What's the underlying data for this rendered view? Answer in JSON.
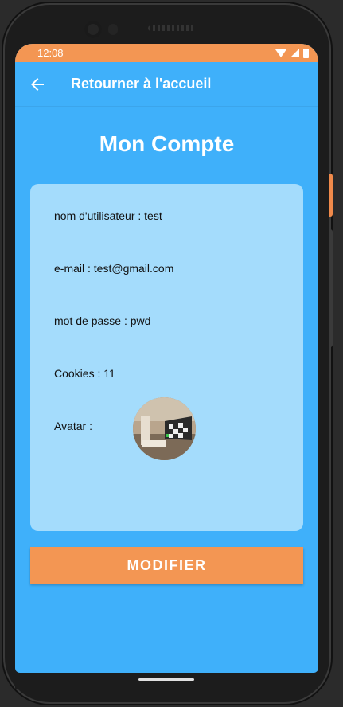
{
  "status_bar": {
    "time": "12:08"
  },
  "app_bar": {
    "title": "Retourner à l'accueil",
    "back_icon": "arrow-left-icon"
  },
  "page": {
    "title": "Mon Compte"
  },
  "account": {
    "username": "nom d'utilisateur : test",
    "email": "e-mail : test@gmail.com",
    "password": "mot de passe : pwd",
    "cookies": "Cookies : 11",
    "avatar_label": "Avatar :"
  },
  "actions": {
    "modify_label": "MODIFIER"
  },
  "colors": {
    "primary": "#3fb0fa",
    "card": "#a4dcfc",
    "accent": "#f39653"
  }
}
